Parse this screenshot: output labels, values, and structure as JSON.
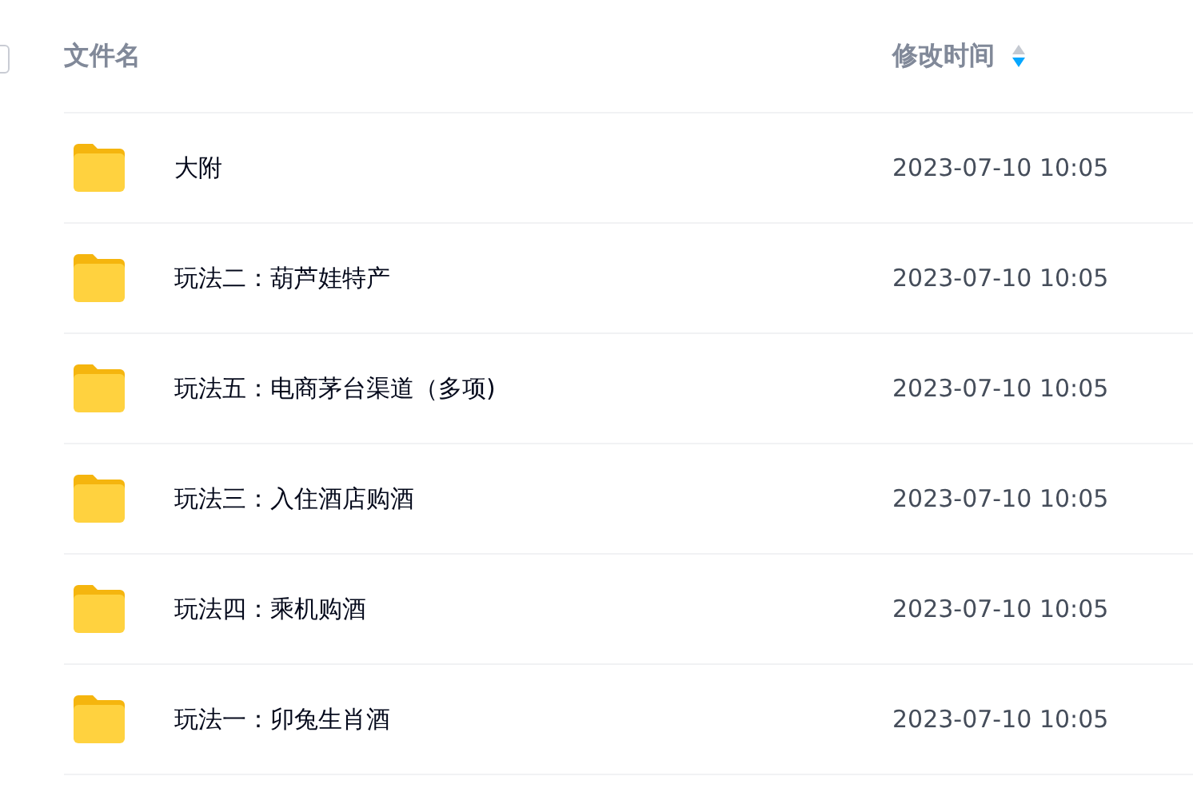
{
  "header": {
    "select_all": {
      "checked": false
    },
    "columns": [
      {
        "label": "文件名"
      },
      {
        "label": "修改时间",
        "sort_descending": true
      }
    ]
  },
  "rows": [
    {
      "name": "大附",
      "modified": "2023-07-10 10:05"
    },
    {
      "name": "玩法二：葫芦娃特产",
      "modified": "2023-07-10 10:05"
    },
    {
      "name": "玩法五：电商茅台渠道（多项)",
      "modified": "2023-07-10 10:05"
    },
    {
      "name": "玩法三：入住酒店购酒",
      "modified": "2023-07-10 10:05"
    },
    {
      "name": "玩法四：乘机购酒",
      "modified": "2023-07-10 10:05"
    },
    {
      "name": "玩法一：卯兔生肖酒",
      "modified": "2023-07-10 10:05"
    }
  ]
}
